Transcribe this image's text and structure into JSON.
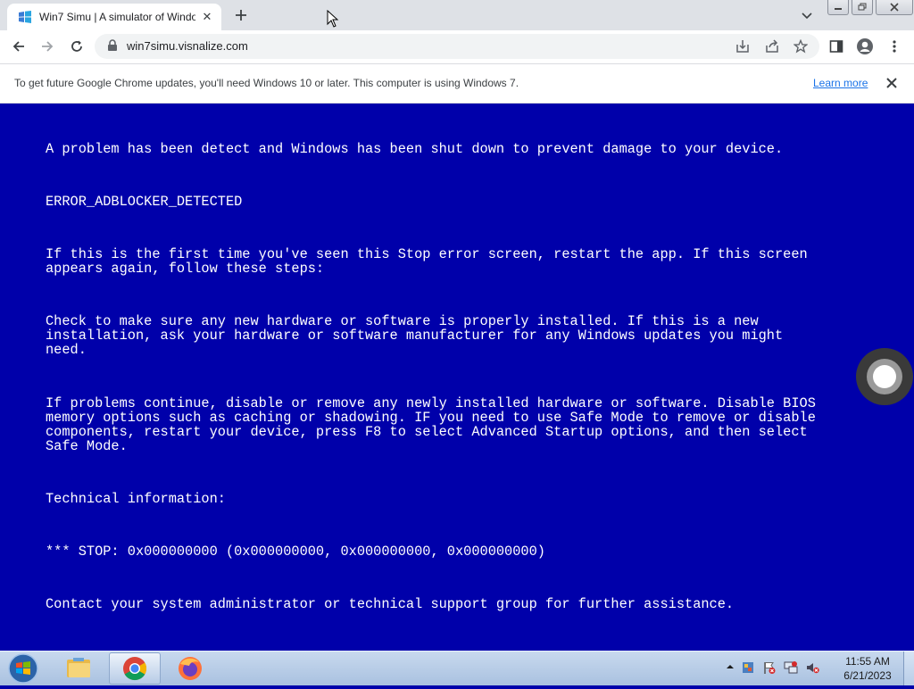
{
  "browser": {
    "tab_title": "Win7 Simu | A simulator of Windows 7",
    "address": "win7simu.visnalize.com"
  },
  "infobar": {
    "message": "To get future Google Chrome updates, you'll need Windows 10 or later. This computer is using Windows 7.",
    "link_label": "Learn more"
  },
  "bsod": {
    "line1": "A problem has been detect and Windows has been shut down to prevent damage to your device.",
    "error_code": "ERROR_ADBLOCKER_DETECTED",
    "first_time": "If this is the first time you've seen this Stop error screen, restart the app. If this screen\nappears again, follow these steps:",
    "check": "Check to make sure any new hardware or software is properly installed. If this is a new\ninstallation, ask your hardware or software manufacturer for any Windows updates you might\nneed.",
    "problems": "If problems continue, disable or remove any newly installed hardware or software. Disable BIOS\nmemory options such as caching or shadowing. IF you need to use Safe Mode to remove or disable\ncomponents, restart your device, press F8 to select Advanced Startup options, and then select\nSafe Mode.",
    "tech_info": "Technical information:",
    "stop_code": "*** STOP: 0x000000000 (0x000000000, 0x000000000, 0x000000000)",
    "contact": "Contact your system administrator or technical support group for further assistance."
  },
  "taskbar": {
    "time": "11:55 AM",
    "date": "6/21/2023",
    "apps": [
      "explorer-icon",
      "chrome-icon",
      "firefox-icon"
    ]
  },
  "colors": {
    "bsod_bg": "#0000aa",
    "link": "#1a73e8"
  }
}
